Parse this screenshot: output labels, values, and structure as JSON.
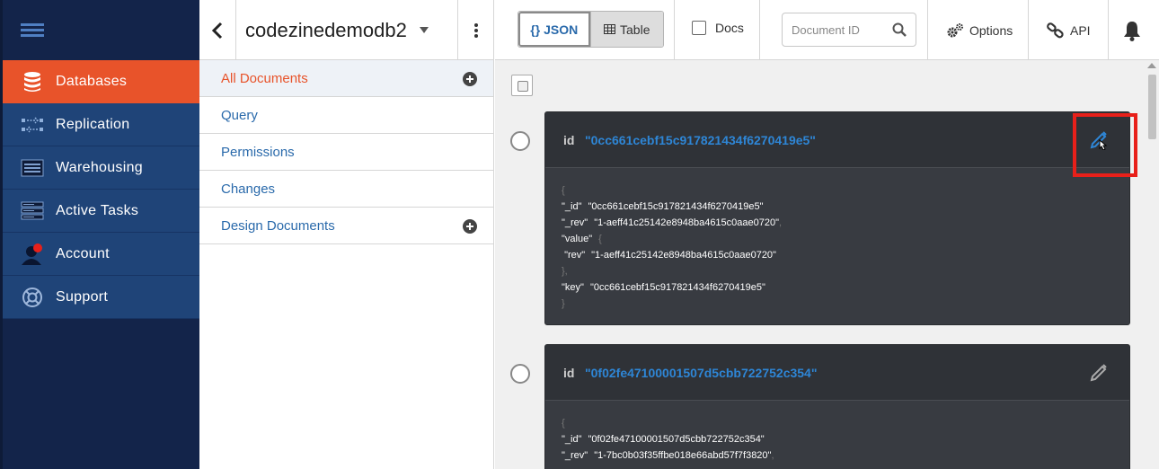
{
  "sidebar": {
    "items": [
      {
        "label": "Databases",
        "icon": "database-icon"
      },
      {
        "label": "Replication",
        "icon": "replication-icon"
      },
      {
        "label": "Warehousing",
        "icon": "warehouse-icon"
      },
      {
        "label": "Active Tasks",
        "icon": "tasks-icon"
      },
      {
        "label": "Account",
        "icon": "account-icon"
      },
      {
        "label": "Support",
        "icon": "support-icon"
      }
    ],
    "active_color": "#e8532a",
    "bg_color": "#13244a"
  },
  "db": {
    "name": "codezinedemodb2",
    "menu": [
      {
        "label": "All Documents"
      },
      {
        "label": "Query"
      },
      {
        "label": "Permissions"
      },
      {
        "label": "Changes"
      },
      {
        "label": "Design Documents"
      }
    ]
  },
  "toolbar": {
    "json_label": "{} JSON",
    "table_label": "Table",
    "docs_label": "Docs",
    "search_placeholder": "Document ID",
    "options_label": "Options",
    "api_label": "API"
  },
  "documents": [
    {
      "id_label": "id",
      "id": "\"0cc661cebf15c917821434f6270419e5\"",
      "lines": [
        {
          "key": "\"_id\"",
          "val": "\"0cc661cebf15c917821434f6270419e5\""
        },
        {
          "key": "\"_rev\"",
          "val": "\"1-aeff41c25142e8948ba4615c0aae0720\""
        },
        {
          "key": "\"value\"",
          "val": ""
        },
        {
          "key": "\"rev\"",
          "val": "\"1-aeff41c25142e8948ba4615c0aae0720\""
        },
        {
          "key": "\"key\"",
          "val": "\"0cc661cebf15c917821434f6270419e5\""
        }
      ]
    },
    {
      "id_label": "id",
      "id": "\"0f02fe47100001507d5cbb722752c354\"",
      "lines": [
        {
          "key": "\"_id\"",
          "val": "\"0f02fe47100001507d5cbb722752c354\""
        },
        {
          "key": "\"_rev\"",
          "val": "\"1-7bc0b03f35ffbe018e66abd57f7f3820\""
        }
      ]
    }
  ]
}
